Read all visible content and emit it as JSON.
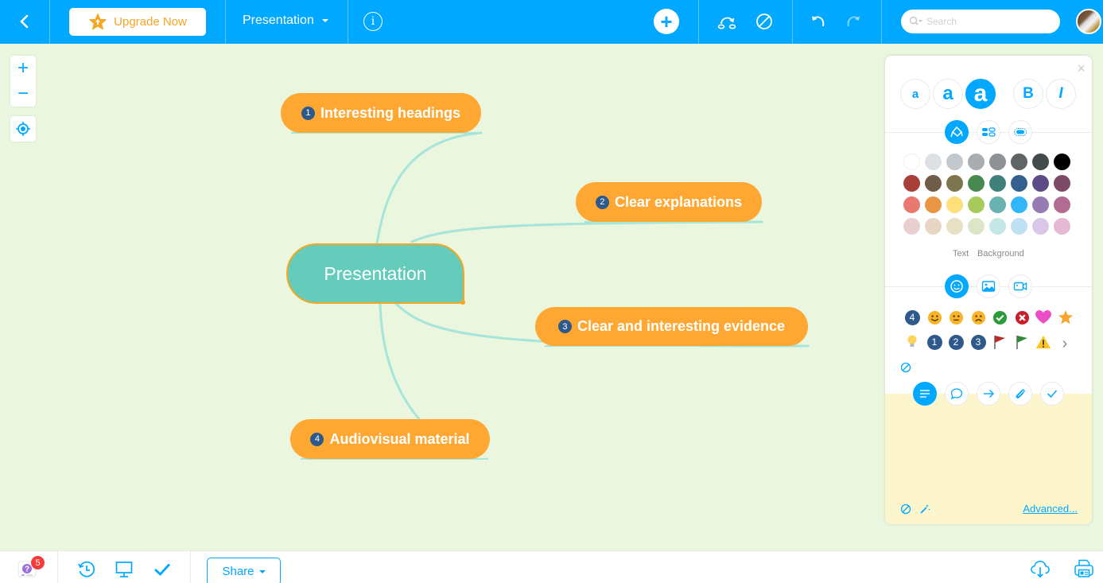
{
  "topbar": {
    "back_label": "Back",
    "upgrade_label": "Upgrade Now",
    "document_title": "Presentation",
    "info_label": "i",
    "add_label": "+",
    "search_placeholder": "Search"
  },
  "zoom_controls": {
    "zoom_in": "+",
    "zoom_out": "−"
  },
  "mindmap": {
    "root": "Presentation",
    "topics": [
      {
        "number": "1",
        "label": "Interesting headings"
      },
      {
        "number": "2",
        "label": "Clear explanations"
      },
      {
        "number": "3",
        "label": "Clear and interesting evidence"
      },
      {
        "number": "4",
        "label": "Audiovisual material"
      }
    ],
    "colors": {
      "topic_fill": "#ffa733",
      "root_fill": "#65cbbb",
      "root_border": "#f5a623",
      "branch": "#a6e5da",
      "marker": "#2d5a8a"
    }
  },
  "panel": {
    "close": "×",
    "font_sizes": [
      "a",
      "a",
      "a"
    ],
    "bold": "B",
    "italic": "I",
    "style_tabs": [
      "paint-style",
      "structure",
      "boundary"
    ],
    "palette": [
      [
        "#ffffff",
        "#dde1e6",
        "#c3c8cc",
        "#a8adb0",
        "#8e9295",
        "#5f6466",
        "#434a4c",
        "#000000"
      ],
      [
        "#a8403a",
        "#6f5d4a",
        "#7d754b",
        "#47894f",
        "#3f807d",
        "#355f8c",
        "#5c4b85",
        "#7d4a68"
      ],
      [
        "#e87870",
        "#e99644",
        "#fde07a",
        "#a6cb5a",
        "#68b2b1",
        "#32b6fa",
        "#977cb4",
        "#b26b93"
      ],
      [
        "#e9cfd0",
        "#e8d6c4",
        "#e6e0c4",
        "#dce6c6",
        "#c4e6e5",
        "#c0e0f3",
        "#d8c7e7",
        "#e5b9d2"
      ]
    ],
    "text_label": "Text",
    "background_label": "Background",
    "media_tabs": [
      "emoji",
      "image",
      "video"
    ],
    "icons_row1": [
      "4",
      "smile",
      "neutral",
      "sad",
      "check",
      "cross",
      "heart",
      "star"
    ],
    "icons_row2": [
      "bulb",
      "1",
      "2",
      "3",
      "red-flag",
      "green-flag",
      "warning"
    ],
    "more": "›",
    "advanced_label": "Advanced..."
  },
  "bottombar": {
    "help_badge_count": "5",
    "share_label": "Share"
  }
}
